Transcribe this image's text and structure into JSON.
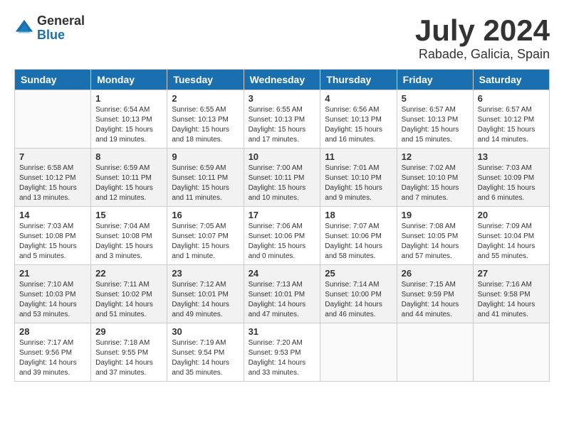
{
  "header": {
    "logo_general": "General",
    "logo_blue": "Blue",
    "month_title": "July 2024",
    "location": "Rabade, Galicia, Spain"
  },
  "calendar": {
    "days_of_week": [
      "Sunday",
      "Monday",
      "Tuesday",
      "Wednesday",
      "Thursday",
      "Friday",
      "Saturday"
    ],
    "weeks": [
      [
        {
          "day": "",
          "info": ""
        },
        {
          "day": "1",
          "info": "Sunrise: 6:54 AM\nSunset: 10:13 PM\nDaylight: 15 hours\nand 19 minutes."
        },
        {
          "day": "2",
          "info": "Sunrise: 6:55 AM\nSunset: 10:13 PM\nDaylight: 15 hours\nand 18 minutes."
        },
        {
          "day": "3",
          "info": "Sunrise: 6:55 AM\nSunset: 10:13 PM\nDaylight: 15 hours\nand 17 minutes."
        },
        {
          "day": "4",
          "info": "Sunrise: 6:56 AM\nSunset: 10:13 PM\nDaylight: 15 hours\nand 16 minutes."
        },
        {
          "day": "5",
          "info": "Sunrise: 6:57 AM\nSunset: 10:13 PM\nDaylight: 15 hours\nand 15 minutes."
        },
        {
          "day": "6",
          "info": "Sunrise: 6:57 AM\nSunset: 10:12 PM\nDaylight: 15 hours\nand 14 minutes."
        }
      ],
      [
        {
          "day": "7",
          "info": "Sunrise: 6:58 AM\nSunset: 10:12 PM\nDaylight: 15 hours\nand 13 minutes."
        },
        {
          "day": "8",
          "info": "Sunrise: 6:59 AM\nSunset: 10:11 PM\nDaylight: 15 hours\nand 12 minutes."
        },
        {
          "day": "9",
          "info": "Sunrise: 6:59 AM\nSunset: 10:11 PM\nDaylight: 15 hours\nand 11 minutes."
        },
        {
          "day": "10",
          "info": "Sunrise: 7:00 AM\nSunset: 10:11 PM\nDaylight: 15 hours\nand 10 minutes."
        },
        {
          "day": "11",
          "info": "Sunrise: 7:01 AM\nSunset: 10:10 PM\nDaylight: 15 hours\nand 9 minutes."
        },
        {
          "day": "12",
          "info": "Sunrise: 7:02 AM\nSunset: 10:10 PM\nDaylight: 15 hours\nand 7 minutes."
        },
        {
          "day": "13",
          "info": "Sunrise: 7:03 AM\nSunset: 10:09 PM\nDaylight: 15 hours\nand 6 minutes."
        }
      ],
      [
        {
          "day": "14",
          "info": "Sunrise: 7:03 AM\nSunset: 10:08 PM\nDaylight: 15 hours\nand 5 minutes."
        },
        {
          "day": "15",
          "info": "Sunrise: 7:04 AM\nSunset: 10:08 PM\nDaylight: 15 hours\nand 3 minutes."
        },
        {
          "day": "16",
          "info": "Sunrise: 7:05 AM\nSunset: 10:07 PM\nDaylight: 15 hours\nand 1 minute."
        },
        {
          "day": "17",
          "info": "Sunrise: 7:06 AM\nSunset: 10:06 PM\nDaylight: 15 hours\nand 0 minutes."
        },
        {
          "day": "18",
          "info": "Sunrise: 7:07 AM\nSunset: 10:06 PM\nDaylight: 14 hours\nand 58 minutes."
        },
        {
          "day": "19",
          "info": "Sunrise: 7:08 AM\nSunset: 10:05 PM\nDaylight: 14 hours\nand 57 minutes."
        },
        {
          "day": "20",
          "info": "Sunrise: 7:09 AM\nSunset: 10:04 PM\nDaylight: 14 hours\nand 55 minutes."
        }
      ],
      [
        {
          "day": "21",
          "info": "Sunrise: 7:10 AM\nSunset: 10:03 PM\nDaylight: 14 hours\nand 53 minutes."
        },
        {
          "day": "22",
          "info": "Sunrise: 7:11 AM\nSunset: 10:02 PM\nDaylight: 14 hours\nand 51 minutes."
        },
        {
          "day": "23",
          "info": "Sunrise: 7:12 AM\nSunset: 10:01 PM\nDaylight: 14 hours\nand 49 minutes."
        },
        {
          "day": "24",
          "info": "Sunrise: 7:13 AM\nSunset: 10:01 PM\nDaylight: 14 hours\nand 47 minutes."
        },
        {
          "day": "25",
          "info": "Sunrise: 7:14 AM\nSunset: 10:00 PM\nDaylight: 14 hours\nand 46 minutes."
        },
        {
          "day": "26",
          "info": "Sunrise: 7:15 AM\nSunset: 9:59 PM\nDaylight: 14 hours\nand 44 minutes."
        },
        {
          "day": "27",
          "info": "Sunrise: 7:16 AM\nSunset: 9:58 PM\nDaylight: 14 hours\nand 41 minutes."
        }
      ],
      [
        {
          "day": "28",
          "info": "Sunrise: 7:17 AM\nSunset: 9:56 PM\nDaylight: 14 hours\nand 39 minutes."
        },
        {
          "day": "29",
          "info": "Sunrise: 7:18 AM\nSunset: 9:55 PM\nDaylight: 14 hours\nand 37 minutes."
        },
        {
          "day": "30",
          "info": "Sunrise: 7:19 AM\nSunset: 9:54 PM\nDaylight: 14 hours\nand 35 minutes."
        },
        {
          "day": "31",
          "info": "Sunrise: 7:20 AM\nSunset: 9:53 PM\nDaylight: 14 hours\nand 33 minutes."
        },
        {
          "day": "",
          "info": ""
        },
        {
          "day": "",
          "info": ""
        },
        {
          "day": "",
          "info": ""
        }
      ]
    ]
  }
}
